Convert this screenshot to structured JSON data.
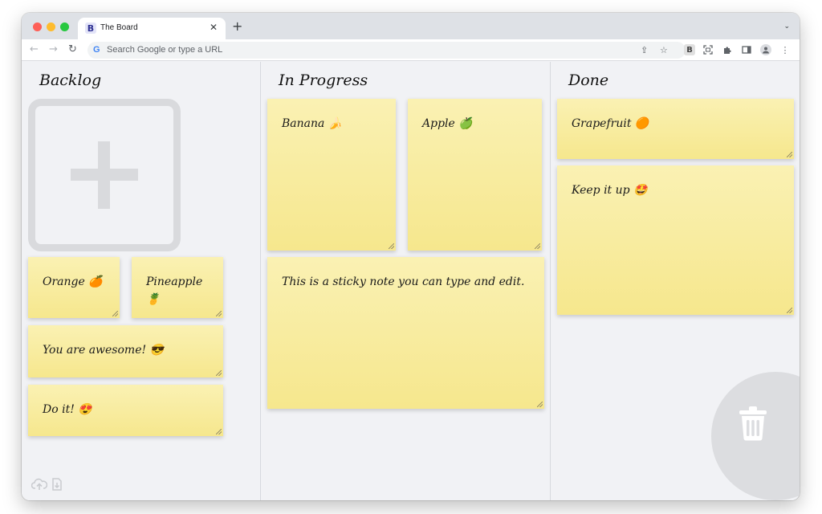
{
  "browser": {
    "tab_title": "The Board",
    "tab_favicon": "B",
    "tab_close": "✕",
    "new_tab": "+",
    "omnibox_placeholder": "Search Google or type a URL",
    "extension_label": "B"
  },
  "board": {
    "columns": [
      {
        "title": "Backlog"
      },
      {
        "title": "In Progress"
      },
      {
        "title": "Done"
      }
    ],
    "notes": {
      "orange": "Orange 🍊",
      "pineapple": "Pineapple 🍍",
      "awesome": "You are awesome! 😎",
      "doit": "Do it! 😍",
      "banana": "Banana 🍌",
      "apple": "Apple 🍏",
      "sticky": "This is a sticky note you can type and edit.",
      "grapefruit": "Grapefruit 🟠",
      "keepitup": "Keep it up 🤩"
    }
  },
  "colors": {
    "note_top": "#faf1b3",
    "note_bottom": "#f6e78d",
    "board_bg": "#f1f2f5",
    "placeholder_gray": "#d9dadd"
  },
  "icons": [
    "cloud-upload-icon",
    "download-icon",
    "trash-icon",
    "add-note-plus-icon"
  ]
}
